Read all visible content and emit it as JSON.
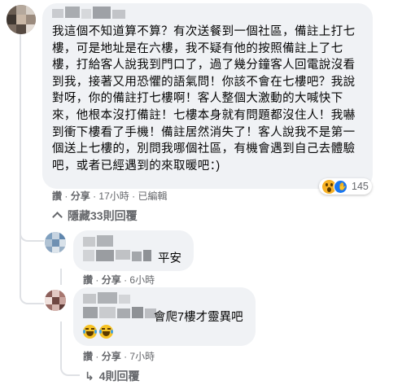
{
  "main_comment": {
    "body": "我這個不知道算不算？有次送餐到一個社區，備註上打七樓，可是地址是在六樓，我不疑有他的按照備註上了七樓，打給客人說我到門口了，過了幾分鐘客人回電說沒看到我，接著又用恐懼的語氣問！你該不會在七樓吧？我說對呀，你的備註打七樓啊！客人整個大激動的大喊快下來，他根本沒打備註！七樓本身就有問題都沒住人！我嚇到衝下樓看了手機！備註居然消失了！客人說我不是第一個送上七樓的，別問我哪個社區，有機會遇到自己去體驗吧，或者已經遇到的來取暖吧：)",
    "reaction_count": "145",
    "actions": {
      "like": "讚",
      "reply": "分享",
      "time": "17小時",
      "edited": "已編輯"
    }
  },
  "hidden_replies": {
    "label": "隱藏33則回覆"
  },
  "replies": [
    {
      "text": "平安",
      "actions": {
        "like": "讚",
        "reply": "分享",
        "time": "6小時"
      }
    },
    {
      "text": "會爬7樓才靈異吧",
      "emoji": "😂😂",
      "actions": {
        "like": "讚",
        "reply": "分享",
        "time": "7小時"
      }
    }
  ],
  "more_replies": {
    "label": "4則回覆"
  },
  "colors": {
    "bubble": "#f0f2f5",
    "meta": "#65676b",
    "like_blue": "#1877f2",
    "thread_line": "#dfe1e5"
  },
  "icons": [
    "reply-arrow-icon",
    "chevron-up-icon",
    "wow-reaction-icon",
    "like-reaction-icon",
    "laugh-emoji-icon"
  ]
}
